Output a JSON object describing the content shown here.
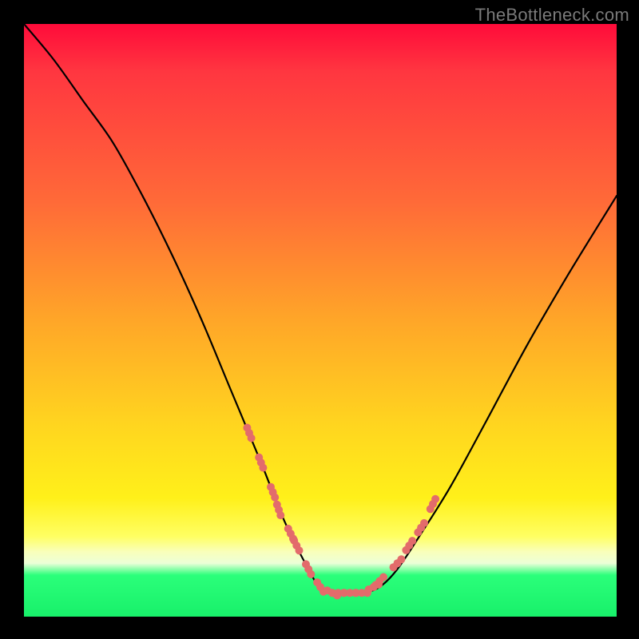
{
  "watermark": "TheBottleneck.com",
  "chart_data": {
    "type": "line",
    "title": "",
    "xlabel": "",
    "ylabel": "",
    "xlim": [
      0,
      100
    ],
    "ylim": [
      0,
      100
    ],
    "series": [
      {
        "name": "bottleneck-curve",
        "x": [
          0,
          5,
          10,
          15,
          20,
          25,
          30,
          35,
          40,
          44,
          48,
          50,
          53,
          57,
          60,
          63,
          67,
          72,
          78,
          85,
          92,
          100
        ],
        "y": [
          100,
          94,
          87,
          80,
          71,
          61,
          50,
          38,
          26,
          16,
          8,
          5,
          4,
          4,
          5,
          8,
          14,
          22,
          33,
          46,
          58,
          71
        ]
      }
    ],
    "markers": {
      "name": "highlighted-points",
      "color": "#e36b6b",
      "x": [
        38,
        40,
        42,
        43,
        45,
        46,
        48,
        50,
        52,
        53,
        55,
        57,
        59,
        60,
        63,
        65,
        67,
        69
      ],
      "y": [
        31,
        26,
        21,
        18,
        14,
        12,
        8,
        5,
        4,
        4,
        4,
        4,
        5,
        6,
        9,
        12,
        15,
        19
      ]
    }
  }
}
